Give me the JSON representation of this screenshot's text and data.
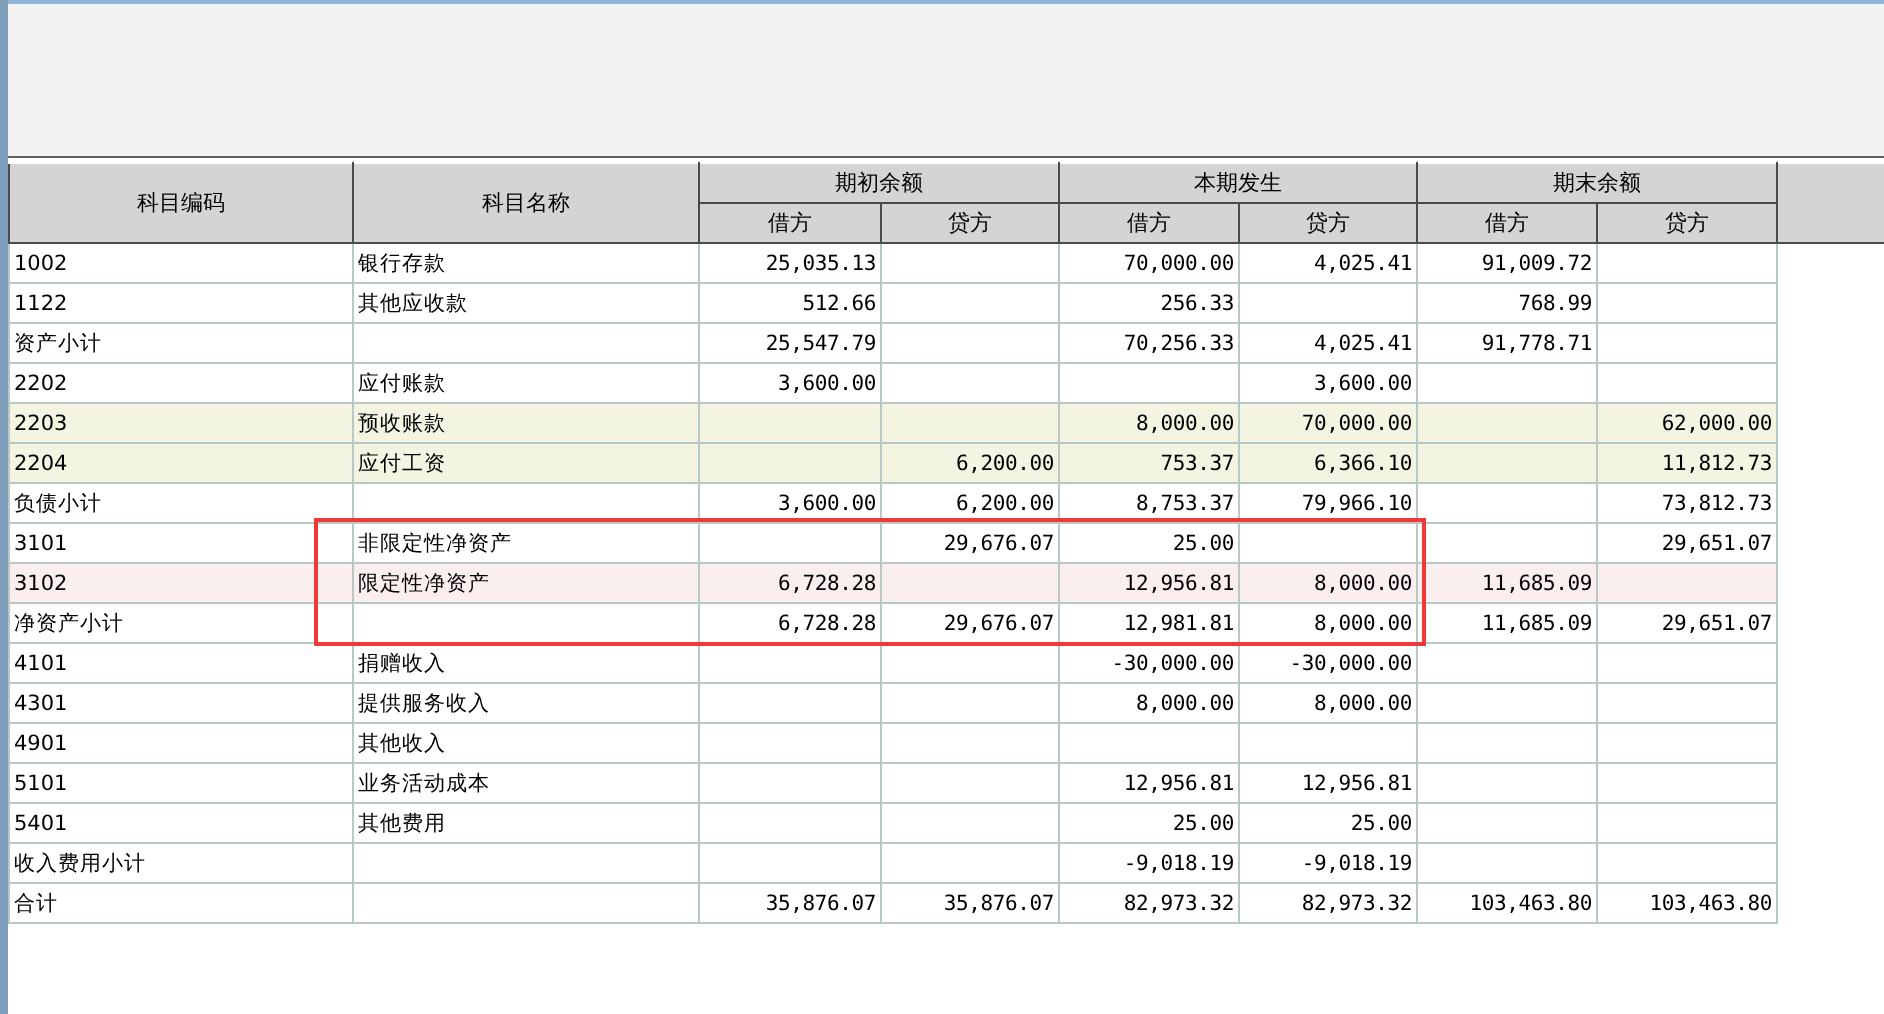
{
  "table": {
    "columns": [
      {
        "label": "科目编码"
      },
      {
        "label": "科目名称"
      },
      {
        "label": "期初余额",
        "children": [
          "借方",
          "贷方"
        ]
      },
      {
        "label": "本期发生",
        "children": [
          "借方",
          "贷方"
        ]
      },
      {
        "label": "期末余额",
        "children": [
          "借方",
          "贷方"
        ]
      }
    ],
    "rows": [
      {
        "code": "1002",
        "name": "银行存款",
        "color": "#ffffff",
        "highlighted": false,
        "values": {
          "opening_debit": "25,035.13",
          "period_debit": "70,000.00",
          "period_credit": "4,025.41",
          "closing_debit": "91,009.72"
        }
      },
      {
        "code": "1122",
        "name": "其他应收款",
        "color": "#ffffff",
        "highlighted": false,
        "values": {
          "opening_debit": "512.66",
          "period_debit": "256.33",
          "closing_debit": "768.99"
        }
      },
      {
        "code": "资产小计",
        "color": "#ffffff",
        "highlighted": false,
        "values": {
          "opening_debit": "25,547.79",
          "period_debit": "70,256.33",
          "period_credit": "4,025.41",
          "closing_debit": "91,778.71"
        }
      },
      {
        "code": "2202",
        "name": "应付账款",
        "color": "#ffffff",
        "highlighted": false,
        "values": {
          "opening_debit": "3,600.00",
          "period_credit": "3,600.00"
        }
      },
      {
        "code": "2203",
        "name": "预收账款",
        "color": "#f3f4e2",
        "highlighted": false,
        "values": {
          "period_debit": "8,000.00",
          "period_credit": "70,000.00",
          "closing_credit": "62,000.00"
        }
      },
      {
        "code": "2204",
        "name": "应付工资",
        "color": "#f3f4e2",
        "highlighted": false,
        "values": {
          "opening_credit": "6,200.00",
          "period_debit": "753.37",
          "period_credit": "6,366.10",
          "closing_credit": "11,812.73"
        }
      },
      {
        "code": "负债小计",
        "color": "#ffffff",
        "highlighted": false,
        "values": {
          "opening_debit": "3,600.00",
          "opening_credit": "6,200.00",
          "period_debit": "8,753.37",
          "period_credit": "79,966.10",
          "closing_credit": "73,812.73"
        }
      },
      {
        "code": "3101",
        "name": "非限定性净资产",
        "color": "#ffffff",
        "highlighted": true,
        "values": {
          "opening_credit": "29,676.07",
          "period_debit": "25.00",
          "closing_credit": "29,651.07"
        }
      },
      {
        "code": "3102",
        "name": "限定性净资产",
        "color": "#fbeeee",
        "highlighted": true,
        "values": {
          "opening_debit": "6,728.28",
          "period_debit": "12,956.81",
          "period_credit": "8,000.00",
          "closing_debit": "11,685.09"
        }
      },
      {
        "code": "净资产小计",
        "color": "#ffffff",
        "highlighted": true,
        "values": {
          "opening_debit": "6,728.28",
          "opening_credit": "29,676.07",
          "period_debit": "12,981.81",
          "period_credit": "8,000.00",
          "closing_debit": "11,685.09",
          "closing_credit": "29,651.07"
        }
      },
      {
        "code": "4101",
        "name": "捐赠收入",
        "color": "#ffffff",
        "highlighted": false,
        "values": {
          "period_debit": "-30,000.00",
          "period_credit": "-30,000.00"
        }
      },
      {
        "code": "4301",
        "name": "提供服务收入",
        "color": "#ffffff",
        "highlighted": false,
        "values": {
          "period_debit": "8,000.00",
          "period_credit": "8,000.00"
        }
      },
      {
        "code": "4901",
        "name": "其他收入",
        "color": "#ffffff",
        "highlighted": false
      },
      {
        "code": "5101",
        "name": "业务活动成本",
        "color": "#ffffff",
        "highlighted": false,
        "values": {
          "period_debit": "12,956.81",
          "period_credit": "12,956.81"
        }
      },
      {
        "code": "5401",
        "name": "其他费用",
        "color": "#ffffff",
        "highlighted": false,
        "values": {
          "period_debit": "25.00",
          "period_credit": "25.00"
        }
      },
      {
        "code": "收入费用小计",
        "color": "#ffffff",
        "highlighted": false,
        "values": {
          "period_debit": "-9,018.19",
          "period_credit": "-9,018.19"
        }
      },
      {
        "code": "合计",
        "color": "#ffffff",
        "highlighted": false,
        "values": {
          "opening_debit": "35,876.07",
          "opening_credit": "35,876.07",
          "period_debit": "82,973.32",
          "period_credit": "82,973.32",
          "closing_debit": "103,463.80",
          "closing_credit": "103,463.80"
        }
      }
    ]
  }
}
